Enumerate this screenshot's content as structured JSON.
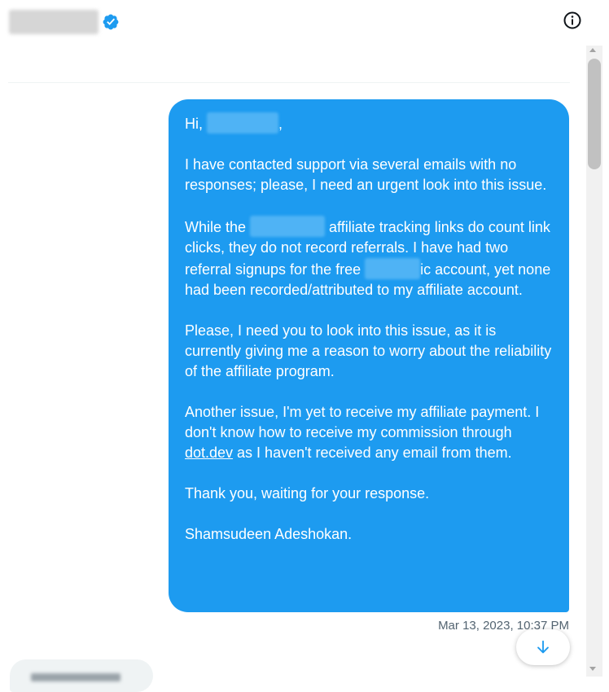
{
  "conversation": {
    "header": {
      "verified_icon": "verified-badge-icon",
      "info_icon": "info-circle-icon"
    },
    "message": {
      "greeting_prefix": "Hi, ",
      "greeting_suffix": ",",
      "para1": "I have contacted support via several emails with no responses; please, I need an urgent look into this issue.",
      "para2_a": "While the ",
      "para2_b": " affiliate tracking links do count link clicks, they do not record referrals. I have had two referral signups for the free ",
      "para2_c": "ic account, yet none had been recorded/attributed to my affiliate account.",
      "para3": "Please, I need you to look into this issue, as it is currently giving me a reason to worry about the reliability of the affiliate program.",
      "para4_a": "Another issue, I'm yet to receive my affiliate payment. I don't know how to receive my commission through ",
      "para4_link": "dot.dev",
      "para4_b": " as I haven't received any email from them.",
      "para5": "Thank you, waiting for your response.",
      "signature": "Shamsudeen Adeshokan."
    },
    "timestamp": "Mar 13, 2023, 10:37 PM",
    "scroll_down_icon": "arrow-down-icon",
    "colors": {
      "bubble": "#1d9bf0",
      "timestamp": "#536471",
      "verified": "#1d9bf0"
    }
  }
}
